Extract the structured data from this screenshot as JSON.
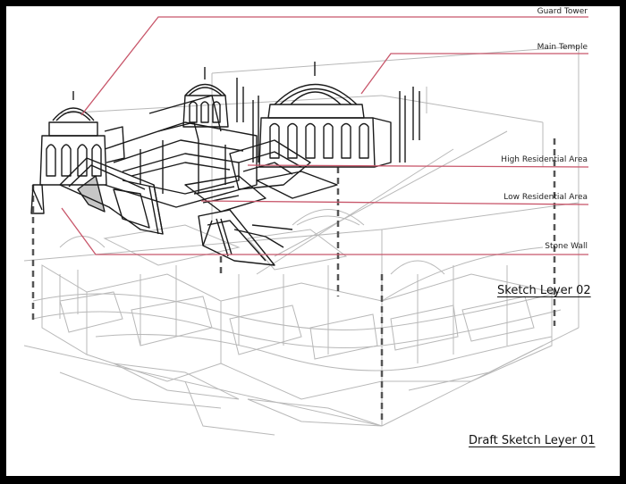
{
  "callouts": [
    {
      "id": "guard-tower",
      "label": "Guard Tower"
    },
    {
      "id": "main-temple",
      "label": "Main Temple"
    },
    {
      "id": "high-residential",
      "label": "High Residential Area"
    },
    {
      "id": "low-residential",
      "label": "Low Residential Area"
    },
    {
      "id": "stone-wall",
      "label": "Stone Wall"
    }
  ],
  "layers": {
    "sketch_02": "Sketch Leyer 02",
    "draft_01": "Draft Sketch Leyer 01"
  },
  "colors": {
    "callout_line": "#c8566a",
    "ink": "#1a1a1a",
    "draft": "#b8b8b8",
    "frame": "#000000",
    "paper": "#ffffff"
  }
}
